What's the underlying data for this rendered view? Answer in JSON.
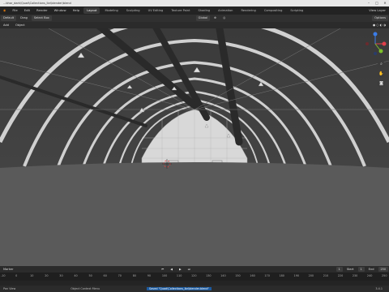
{
  "window": {
    "title": "...bhar_dark\\Quad\\Collections_lbr\\blender\\blend",
    "controls": [
      "–",
      "□",
      "✕"
    ]
  },
  "menubar": {
    "items": [
      "File",
      "Edit",
      "Render",
      "Window",
      "Help"
    ],
    "workspaces": [
      "Layout",
      "Modeling",
      "Sculpting",
      "UV Editing",
      "Texture Paint",
      "Shading",
      "Animation",
      "Rendering",
      "Compositing",
      "Scripting"
    ],
    "active_workspace": "Layout",
    "right_label": "View Layer"
  },
  "header": {
    "mode": "Default",
    "drag": "Drag",
    "select": "Select Box",
    "orientation": "Global",
    "options": "Options"
  },
  "view_header": {
    "items": [
      "Add",
      "Object"
    ]
  },
  "timeline": {
    "label": "Marker",
    "current_frame": "1",
    "start_label": "Start",
    "start": "1",
    "end_label": "End",
    "end": "250",
    "ruler": [
      "-10",
      "0",
      "10",
      "20",
      "30",
      "40",
      "50",
      "60",
      "70",
      "80",
      "90",
      "100",
      "110",
      "120",
      "130",
      "140",
      "150",
      "160",
      "170",
      "180",
      "190",
      "200",
      "210",
      "220",
      "230",
      "240",
      "250"
    ]
  },
  "status": {
    "left": "Pan View",
    "middle": "Object Context Menu",
    "highlight": "Saved \"Quad\\Collections_lbr\\blender.blend\"",
    "version": "3.4.1"
  },
  "colors": {
    "accent": "#1c5a9e",
    "gizmo_x": "#e0404a",
    "gizmo_y": "#7cbf2a",
    "gizmo_z": "#3b7de8"
  },
  "icons": [
    "camera-icon",
    "hand-icon",
    "zoom-icon",
    "play-icon",
    "navigation-gizmo"
  ]
}
